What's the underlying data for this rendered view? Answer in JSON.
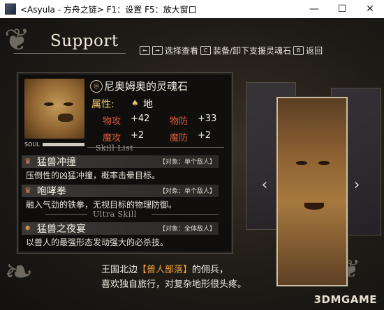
{
  "window": {
    "title": "<Asyula - 方舟之链> F1：设置  F5：放大窗口",
    "minimize_glyph": "—",
    "maximize_glyph": "☐",
    "close_glyph": "✕"
  },
  "header": {
    "title": "Support"
  },
  "help": {
    "nav_key_left": "←",
    "nav_key_right": "→",
    "nav_text": "选择查看",
    "c_key": "C",
    "c_text": "装备/卸下支援灵魂石",
    "b_key": "B",
    "b_text": "返回"
  },
  "stone": {
    "icon": "soul-stone-icon",
    "icon_glyph": "◎",
    "name": "尼奥姆奥的灵魂石",
    "attribute_label": "属性:",
    "attribute_icon_glyph": "♠",
    "attribute_value": "地",
    "soul_label": "SOUL",
    "soul_fill_percent": 100,
    "stats": [
      {
        "label": "物攻",
        "value": "+42"
      },
      {
        "label": "物防",
        "value": "+33"
      },
      {
        "label": "魔攻",
        "value": "+2"
      },
      {
        "label": "魔防",
        "value": "+2"
      }
    ]
  },
  "skill_list_label": "Skill List",
  "skills": [
    {
      "icon_glyph": "♛",
      "name": "猛兽冲撞",
      "target": "【对象：单个敌人】",
      "desc": "压倒性的凶猛冲撞，概率击晕目标。"
    },
    {
      "icon_glyph": "♛",
      "name": "咆哮拳",
      "target": "【对象：单个敌人】",
      "desc": "融入气劲的铁拳，无视目标的物理防御。"
    }
  ],
  "ultra_label": "Ultra Skill",
  "ultra": {
    "icon_glyph": "✸",
    "name": "猛兽之夜宴",
    "target": "【对象：全体敌人】",
    "desc": "以兽人的最强形态发动强大的必杀技。"
  },
  "nav": {
    "left": "‹",
    "right": "›"
  },
  "footer": {
    "line1_prefix": "王国北边",
    "line1_highlight": "【兽人部落】",
    "line1_suffix": "的佣兵，",
    "line2": "喜欢独自旅行，对复杂地形很头疼。"
  },
  "watermark": "3DMGAME",
  "colors": {
    "accent_red": "#e05a3a",
    "accent_gold": "#f0c96a",
    "highlight_orange": "#f2a03a"
  }
}
